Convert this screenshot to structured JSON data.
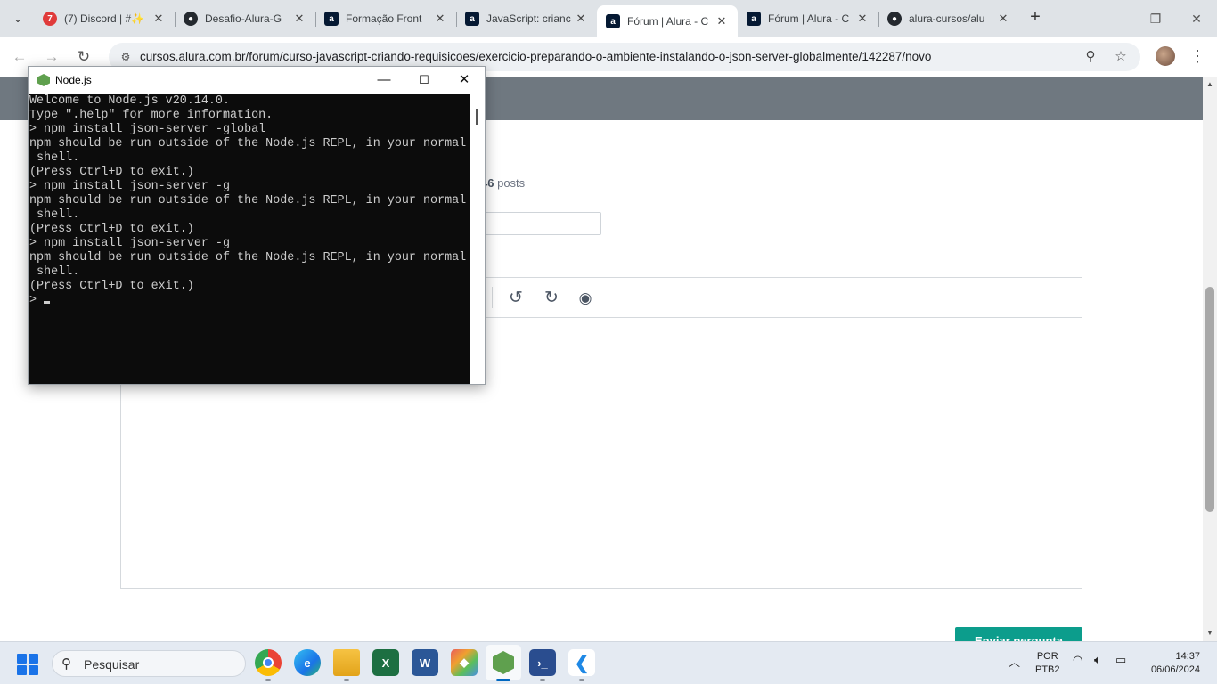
{
  "browser": {
    "tabs": [
      {
        "title": "(7) Discord | #✨",
        "icon": "discord-icon",
        "color": "#e03b3b"
      },
      {
        "title": "Desafio-Alura-G",
        "icon": "github-icon",
        "color": "#24292f"
      },
      {
        "title": "Formação Front",
        "icon": "alura-icon",
        "color": "#051933"
      },
      {
        "title": "JavaScript: crianc",
        "icon": "alura-icon",
        "color": "#051933"
      },
      {
        "title": "Fórum | Alura - C",
        "icon": "alura-icon",
        "color": "#051933"
      },
      {
        "title": "Fórum | Alura - C",
        "icon": "alura-icon",
        "color": "#051933"
      },
      {
        "title": "alura-cursos/alu",
        "icon": "github-icon",
        "color": "#24292f"
      }
    ],
    "active_tab": 4,
    "url": "cursos.alura.com.br/forum/curso-javascript-criando-requisicoes/exercicio-preparando-o-ambiente-instalando-o-json-server-globalmente/142287/novo"
  },
  "page": {
    "posts_count": "46",
    "posts_label": "posts",
    "submit_label": "Enviar pergunta"
  },
  "node_window": {
    "title": "Node.js",
    "lines": [
      "Welcome to Node.js v20.14.0.",
      "Type \".help\" for more information.",
      "> npm install json-server -global",
      "npm should be run outside of the Node.js REPL, in your normal",
      " shell.",
      "(Press Ctrl+D to exit.)",
      "> npm install json-server -g",
      "npm should be run outside of the Node.js REPL, in your normal",
      " shell.",
      "(Press Ctrl+D to exit.)",
      "> npm install json-server -g",
      "npm should be run outside of the Node.js REPL, in your normal",
      " shell.",
      "(Press Ctrl+D to exit.)"
    ],
    "prompt": "> "
  },
  "taskbar": {
    "search_placeholder": "Pesquisar",
    "apps": [
      {
        "name": "chrome-icon"
      },
      {
        "name": "edge-icon"
      },
      {
        "name": "file-explorer-icon"
      },
      {
        "name": "excel-icon"
      },
      {
        "name": "word-icon"
      },
      {
        "name": "git-icon"
      },
      {
        "name": "nodejs-icon"
      },
      {
        "name": "powershell-icon"
      },
      {
        "name": "vscode-icon"
      }
    ],
    "lang_line1": "POR",
    "lang_line2": "PTB2",
    "time": "14:37",
    "date": "06/06/2024"
  }
}
